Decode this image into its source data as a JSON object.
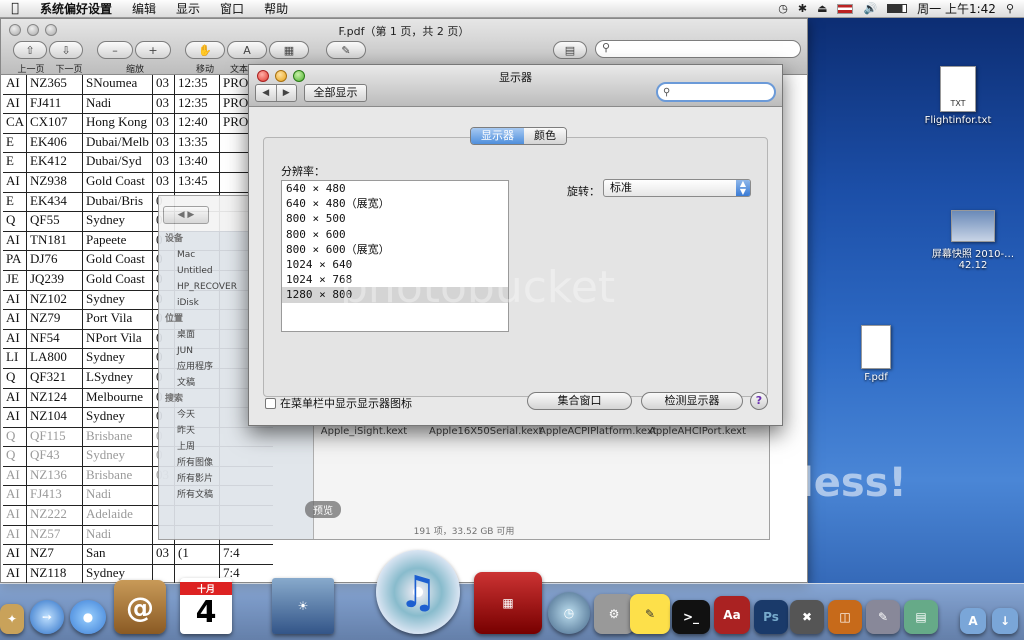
{
  "menubar": {
    "apple": "",
    "items": [
      "系统偏好设置",
      "编辑",
      "显示",
      "窗口",
      "帮助"
    ],
    "clock": "周一 上午1:42"
  },
  "preview": {
    "title": "F.pdf（第 1 页，共 2 页）",
    "toolbar_labels": {
      "prev": "上一页",
      "next": "下一页",
      "zoom": "缩放",
      "move": "移动",
      "text": "文本",
      "select": "选择",
      "annotate": "注释",
      "sidebar": "边栏",
      "search": "搜索"
    },
    "rows": [
      [
        "AI",
        "NZ365",
        "SNoumea",
        "03",
        "12:35",
        "PRO"
      ],
      [
        "AI",
        "FJ411",
        "Nadi",
        "03",
        "12:35",
        "PRO"
      ],
      [
        "CA",
        "CX107",
        "Hong Kong",
        "03",
        "12:40",
        "PRO"
      ],
      [
        "E",
        "EK406",
        "Dubai/Melb",
        "03",
        "13:35",
        ""
      ],
      [
        "E",
        "EK412",
        "Dubai/Syd",
        "03",
        "13:40",
        ""
      ],
      [
        "AI",
        "NZ938",
        "Gold Coast",
        "03",
        "13:45",
        ""
      ],
      [
        "E",
        "EK434",
        "Dubai/Bris",
        "0",
        ""
      ],
      [
        "Q",
        "QF55",
        "Sydney",
        "0",
        ""
      ],
      [
        "AI",
        "TN181",
        "Papeete",
        "0",
        ""
      ],
      [
        "PA",
        "DJ76",
        "Gold Coast",
        "0",
        ""
      ],
      [
        "JE",
        "JQ239",
        "Gold Coast",
        "0",
        ""
      ],
      [
        "AI",
        "NZ102",
        "Sydney",
        "0",
        ""
      ],
      [
        "AI",
        "NZ79",
        "Port Vila",
        "0",
        ""
      ],
      [
        "AI",
        "NF54",
        "NPort Vila",
        "0",
        ""
      ],
      [
        "LI",
        "LA800",
        "Sydney",
        "0",
        ""
      ],
      [
        "Q",
        "QF321",
        "LSydney",
        "0",
        ""
      ],
      [
        "AI",
        "NZ124",
        "Melbourne",
        "0",
        ""
      ],
      [
        "AI",
        "NZ104",
        "Sydney",
        "0",
        ""
      ],
      [
        "Q",
        "QF115",
        "Brisbane",
        "0",
        ""
      ],
      [
        "Q",
        "QF43",
        "Sydney",
        "0",
        ""
      ],
      [
        "AI",
        "NZ136",
        "Brisbane",
        "03",
        ""
      ],
      [
        "AI",
        "FJ413",
        "Nadi",
        "",
        ""
      ],
      [
        "AI",
        "NZ222",
        "Adelaide",
        "",
        ""
      ],
      [
        "AI",
        "NZ57",
        "Nadi",
        "",
        ""
      ],
      [
        "AI",
        "NZ7",
        "San",
        "03",
        "(1",
        "7:4"
      ],
      [
        "AI",
        "NZ118",
        "Sydney",
        "",
        "",
        "7:4"
      ]
    ]
  },
  "finder": {
    "sidebar": [
      "设备",
      "Mac",
      "Untitled",
      "HP_RECOVER",
      "iDisk",
      "位置",
      "桌面",
      "JUN",
      "应用程序",
      "文稿",
      "搜索",
      "今天",
      "昨天",
      "上周",
      "所有图像",
      "所有影片",
      "所有文稿"
    ],
    "files": [
      "Apple_iSight.kext",
      "Apple16X50Serial.kext",
      "AppleACPIPlatform.kext",
      "AppleAHCIPort.kext"
    ],
    "status": "191 项，33.52 GB 可用",
    "tooltip": "预览"
  },
  "display_prefs": {
    "title": "显示器",
    "show_all": "全部显示",
    "tabs": [
      "显示器",
      "颜色"
    ],
    "resolution_label": "分辨率：",
    "resolutions": [
      "640 × 480",
      "640 × 480（展宽）",
      "800 × 500",
      "800 × 600",
      "800 × 600（展宽）",
      "1024 × 640",
      "1024 × 768",
      "1280 × 800"
    ],
    "selected_resolution": "1280 × 800",
    "rotation_label": "旋转：",
    "rotation_value": "标准",
    "menubar_checkbox": "在菜单栏中显示显示器图标",
    "gather_button": "集合窗口",
    "detect_button": "检测显示器",
    "help": "?"
  },
  "desktop": {
    "icons": [
      {
        "label": "Flightinfor.txt",
        "badge": "TXT"
      },
      {
        "label": "屏幕快照 2010-…42.12",
        "badge": ""
      },
      {
        "label": "F.pdf",
        "badge": ""
      }
    ],
    "watermark": "photobucket",
    "watermark_tail": "less!"
  },
  "dock": {
    "calendar_month": "十月",
    "calendar_day": "4",
    "address_book": "@",
    "dictionary": "Aa",
    "photoshop": "Ps"
  }
}
